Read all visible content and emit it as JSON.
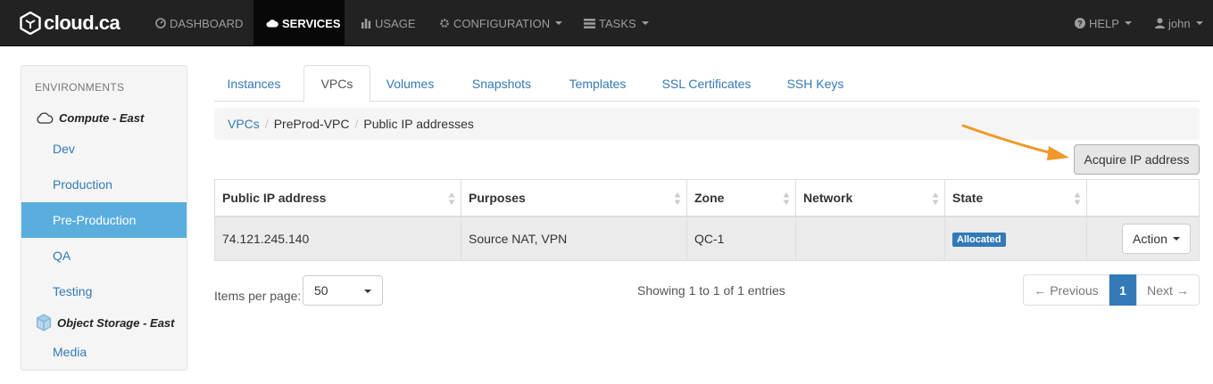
{
  "brand": {
    "name": "cloud.ca"
  },
  "nav": {
    "items": [
      {
        "label": "DASHBOARD",
        "icon": "dashboard-icon"
      },
      {
        "label": "SERVICES",
        "icon": "cloud-icon"
      },
      {
        "label": "USAGE",
        "icon": "bar-chart-icon"
      },
      {
        "label": "CONFIGURATION",
        "icon": "gear-icon"
      },
      {
        "label": "TASKS",
        "icon": "tasks-icon"
      }
    ],
    "help": "HELP",
    "user": "john"
  },
  "sidebar": {
    "heading": "ENVIRONMENTS",
    "groups": [
      {
        "label": "Compute - East",
        "icon": "cloud-outline-icon"
      },
      {
        "label": "Object Storage - East",
        "icon": "storage-cube-icon"
      }
    ],
    "items": [
      {
        "label": "Dev"
      },
      {
        "label": "Production"
      },
      {
        "label": "Pre-Production"
      },
      {
        "label": "QA"
      },
      {
        "label": "Testing"
      },
      {
        "label": "Media"
      }
    ]
  },
  "tabs": [
    "Instances",
    "VPCs",
    "Volumes",
    "Snapshots",
    "Templates",
    "SSL Certificates",
    "SSH Keys"
  ],
  "breadcrumb": [
    "VPCs",
    "PreProd-VPC",
    "Public IP addresses"
  ],
  "acquire_button": "Acquire IP address",
  "table": {
    "columns": [
      "Public IP address",
      "Purposes",
      "Zone",
      "Network",
      "State"
    ],
    "rows": [
      {
        "ip": "74.121.245.140",
        "purposes": "Source NAT, VPN",
        "zone": "QC-1",
        "network": "",
        "state": "Allocated",
        "action": "Action"
      }
    ]
  },
  "footer": {
    "items_per_page_label": "Items per page:",
    "items_per_page": "50",
    "showing": "Showing 1 to 1 of 1 entries",
    "previous": "← Previous",
    "page": "1",
    "next": "Next →"
  },
  "colors": {
    "accent": "#337ab7",
    "active_sidebar": "#5aaede",
    "arrow": "#f0982a",
    "navbar": "#222222"
  }
}
